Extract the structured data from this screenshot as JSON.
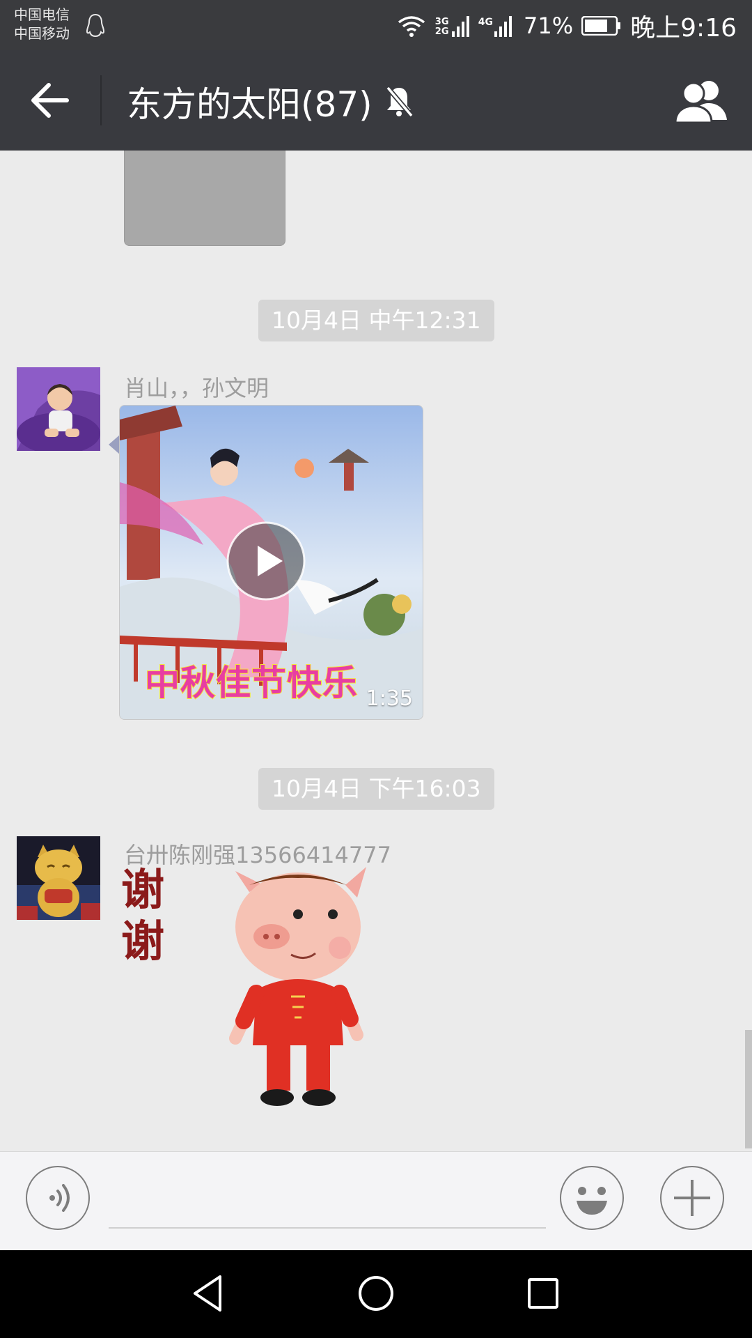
{
  "status_bar": {
    "carrier_1": "中国电信",
    "carrier_2": "中国移动",
    "network_1": "3G 2G",
    "network_2": "4G",
    "battery": "71%",
    "time": "晚上9:16"
  },
  "header": {
    "title": "东方的太阳(87)",
    "icons": {
      "back": "arrow-left-icon",
      "mute": "bell-off-icon",
      "members": "group-icon"
    }
  },
  "messages": [
    {
      "type": "timestamp",
      "text": "10月4日 中午12:31"
    },
    {
      "type": "video",
      "sender": "肖山，，孙文明",
      "duration": "1:35",
      "caption": "中秋佳节快乐"
    },
    {
      "type": "timestamp",
      "text": "10月4日 下午16:03"
    },
    {
      "type": "sticker",
      "sender": "台卅陈刚强13566414777",
      "text": "谢谢"
    }
  ],
  "input_bar": {
    "icons": {
      "voice": "voice-icon",
      "emoji": "smiley-icon",
      "more": "plus-icon"
    }
  },
  "nav_bar": {
    "icons": {
      "back": "triangle-back-icon",
      "home": "circle-home-icon",
      "recents": "square-recents-icon"
    }
  }
}
